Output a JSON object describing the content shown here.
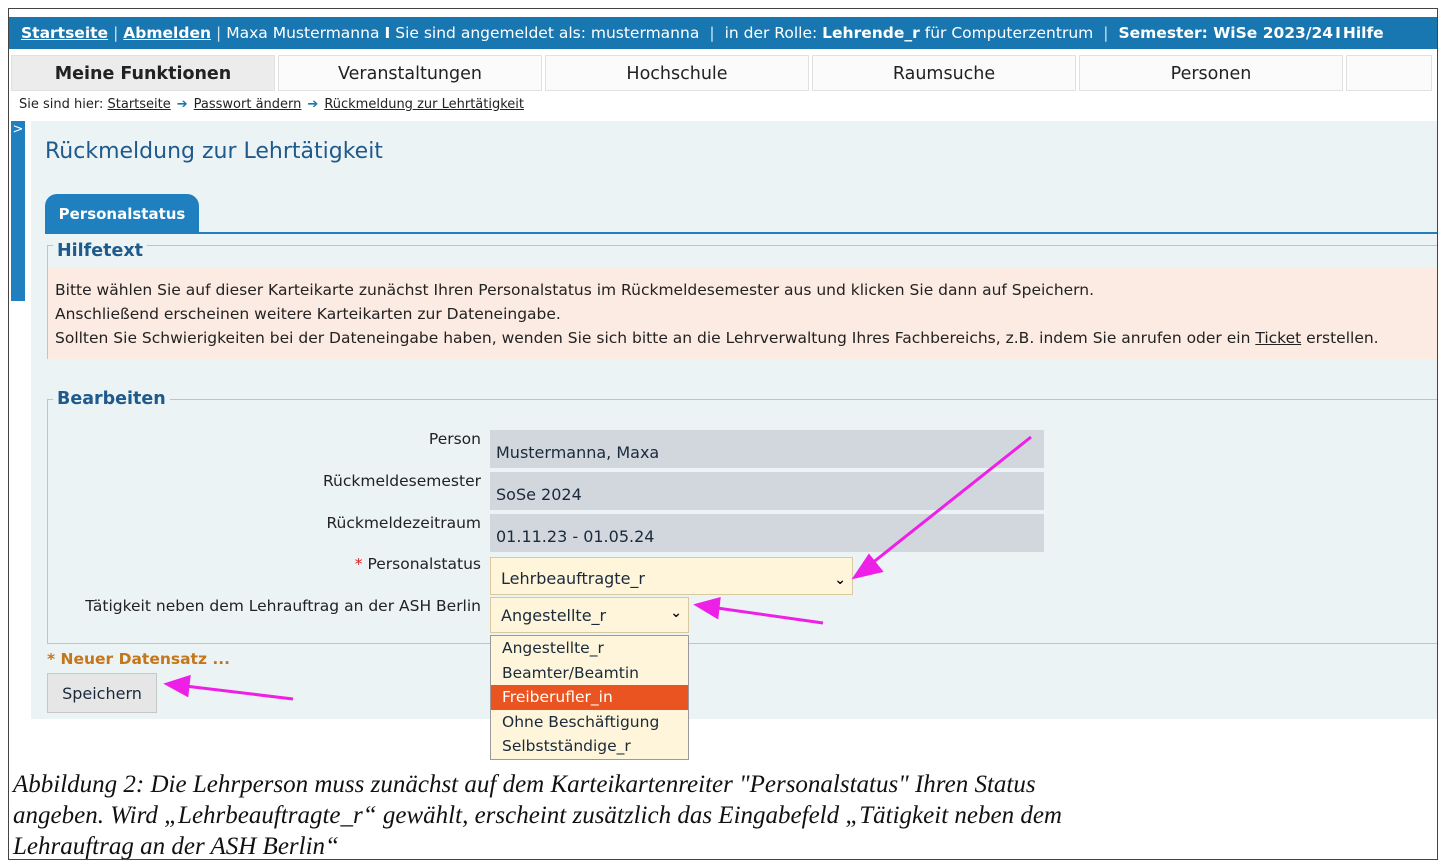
{
  "topbar": {
    "home": "Startseite",
    "logout": "Abmelden",
    "user": "Maxa Mustermanna",
    "logged_in_as": "Sie sind angemeldet als: mustermanna",
    "role_prefix": "in der Rolle:",
    "role": "Lehrende_r",
    "role_for": "für",
    "org": "Computerzentrum",
    "semester": "Semester: WiSe 2023/24",
    "help": "Hilfe"
  },
  "nav": {
    "items": [
      "Meine Funktionen",
      "Veranstaltungen",
      "Hochschule",
      "Raumsuche",
      "Personen"
    ]
  },
  "breadcrumb": {
    "prefix": "Sie sind hier:",
    "items": [
      "Startseite",
      "Passwort ändern",
      "Rückmeldung zur Lehrtätigkeit"
    ]
  },
  "side_toggle": ">",
  "page": {
    "title": "Rückmeldung zur Lehrtätigkeit",
    "tab": "Personalstatus"
  },
  "help": {
    "legend": "Hilfetext",
    "line1": "Bitte wählen Sie auf dieser Karteikarte zunächst Ihren Personalstatus im Rückmeldesemester aus und klicken Sie dann auf Speichern.",
    "line2": "Anschließend erscheinen weitere Karteikarten zur Dateneingabe.",
    "line3_pre": "Sollten Sie Schwierigkeiten bei der Dateneingabe haben, wenden Sie sich bitte an die Lehrverwaltung Ihres Fachbereichs, z.B. indem Sie anrufen oder ein ",
    "line3_link": "Ticket",
    "line3_post": " erstellen."
  },
  "form": {
    "legend": "Bearbeiten",
    "person_label": "Person",
    "person_value": "Mustermanna, Maxa",
    "semester_label": "Rückmeldesemester",
    "semester_value": "SoSe 2024",
    "period_label": "Rückmeldezeitraum",
    "period_value": "01.11.23 - 01.05.24",
    "required_mark": "*",
    "status_label": "Personalstatus",
    "status_value": "Lehrbeauftragte_r",
    "activity_label": "Tätigkeit neben dem Lehrauftrag an der ASH Berlin",
    "activity_value": "Angestellte_r",
    "activity_options": [
      "Angestellte_r",
      "Beamter/Beamtin",
      "Freiberufler_in",
      "Ohne Beschäftigung",
      "Selbstständige_r"
    ],
    "highlighted_option": "Freiberufler_in",
    "new_record": "Neuer Datensatz ...",
    "save_label": "Speichern"
  },
  "caption": {
    "line1": "Abbildung 2: Die Lehrperson muss zunächst auf dem Karteikartenreiter \"Personalstatus\" Ihren Status",
    "line2": "angeben. Wird „Lehrbeauftragte_r“ gewählt, erscheint zusätzlich das Eingabefeld „Tätigkeit neben dem",
    "line3": "Lehrauftrag an der ASH Berlin“"
  },
  "colors": {
    "accent": "#1f7fbf",
    "annotation_arrow": "#ee1fe6",
    "highlight": "#e95420",
    "required": "#d01f1f"
  }
}
